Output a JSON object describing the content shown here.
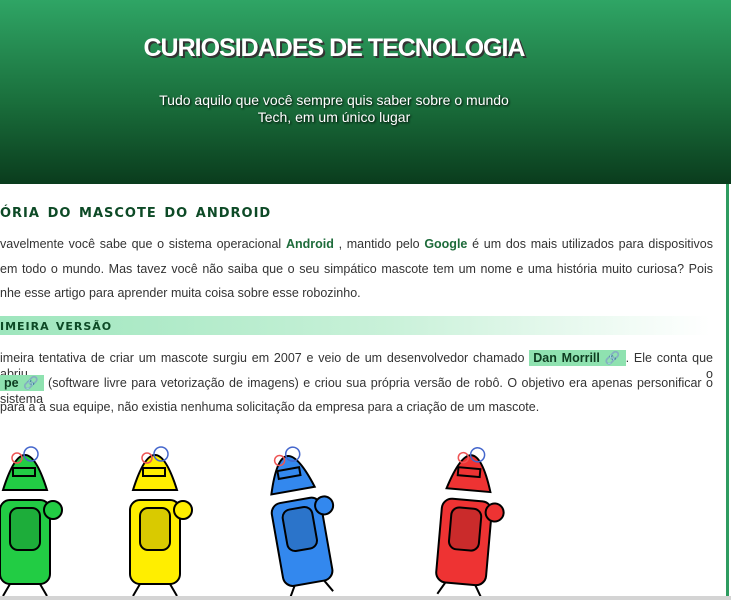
{
  "header": {
    "title": "CURIOSIDADES DE TECNOLOGIA",
    "subtitle_line1": "Tudo aquilo que você sempre quis saber sobre o mundo",
    "subtitle_line2": "Tech, em um único lugar"
  },
  "article": {
    "heading": "ória do mascote do android",
    "intro": {
      "l1_a": "vavelmente você sabe que o sistema operacional",
      "android": "Android",
      "l1_b": ", mantido pelo",
      "google": "Google",
      "l1_c": "é um dos mais utilizados para dispositivos",
      "l2": "em todo o mundo. Mas tavez você não saiba que o seu simpático mascote tem um nome e uma história muito curiosa? Pois",
      "l3": "nhe esse artigo para aprender muita coisa sobre esse robozinho."
    },
    "section_heading": "imeira versão",
    "section": {
      "l1_a": "imeira tentativa de criar um mascote surgiu em 2007 e veio de um desenvolvedor chamado",
      "dan_link": "Dan Morrill",
      "l1_b": ". Ele conta que abriu o",
      "pe_link": "pe",
      "l2": "(software livre para vetorização de imagens) e criou sua própria versão de robô. O objetivo era apenas personificar o sistema",
      "l3": "para a a sua equipe, não existia nenhuma solicitação da empresa para a criação de um mascote."
    },
    "link_icon": "🔗",
    "robot_colors": [
      "#22cc44",
      "#ffee00",
      "#3388ee",
      "#ee3333"
    ]
  }
}
